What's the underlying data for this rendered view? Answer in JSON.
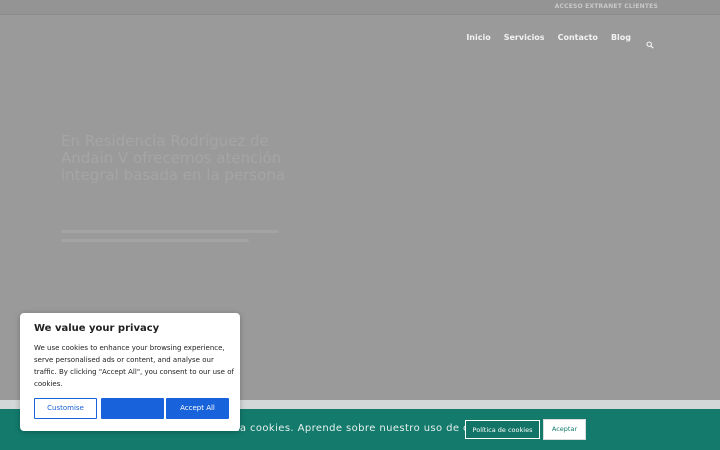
{
  "topbar": {
    "extranet_label": "ACCESO EXTRANET CLIENTES"
  },
  "nav": {
    "items": [
      {
        "label": "Inicio"
      },
      {
        "label": "Servicios"
      },
      {
        "label": "Contacto"
      },
      {
        "label": "Blog"
      }
    ],
    "search_icon": "search-icon"
  },
  "hero": {
    "title": "En Residencia Rodríguez de Andain V ofrecemos atención integral basada en la persona"
  },
  "privacy_popup": {
    "title": "We value your privacy",
    "text": "We use cookies to enhance your browsing experience, serve personalised ads or content, and analyse our traffic. By clicking \"Accept All\", you consent to our use of cookies.",
    "customise_label": "Customise",
    "middle_label": "",
    "accept_all_label": "Accept All",
    "accent_color": "#1863dc"
  },
  "cookie_bar": {
    "text": "Este sitio web utiliza cookies. Aprende sobre nuestro uso de cookies:",
    "policy_label": "Política de cookies",
    "accept_label": "Aceptar",
    "background_color": "#137a6c"
  }
}
